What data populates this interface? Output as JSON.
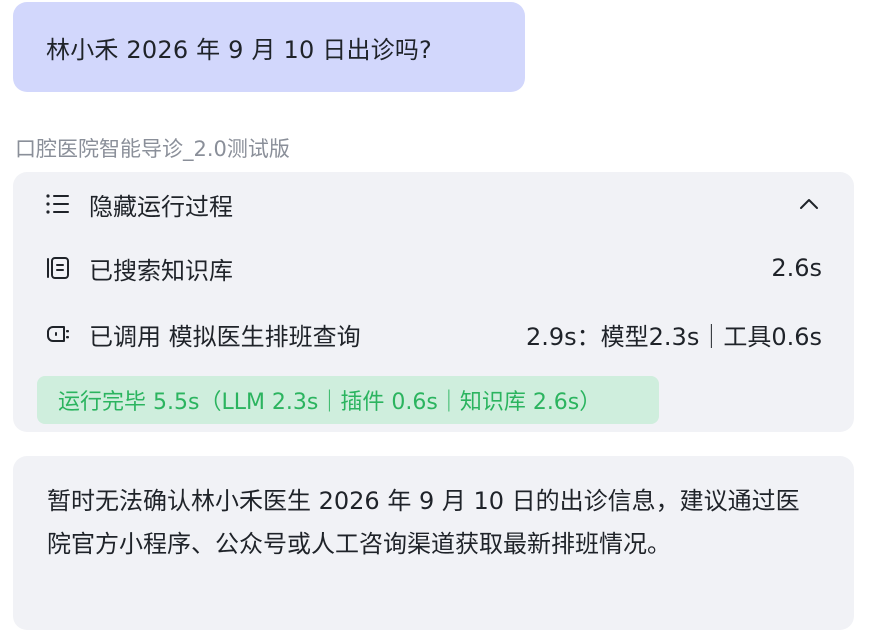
{
  "user_message": {
    "text": "林小禾 2026 年 9 月 10 日出诊吗?"
  },
  "bot": {
    "name": "口腔医院智能导诊_2.0测试版"
  },
  "process": {
    "toggle_label": "隐藏运行过程",
    "toggle_icon": "list-icon",
    "collapse_icon": "chevron-up-icon",
    "steps": [
      {
        "icon": "document-icon",
        "label": "已搜索知识库",
        "duration": "2.6s"
      },
      {
        "icon": "plugin-icon",
        "label": "已调用 模拟医生排班查询",
        "duration": "2.9s：模型2.3s｜工具0.6s"
      }
    ],
    "status": "运行完毕 5.5s（LLM 2.3s｜插件 0.6s｜知识库 2.6s）"
  },
  "answer": {
    "text": "暂时无法确认林小禾医生 2026 年 9 月 10 日的出诊信息，建议通过医院官方小程序、公众号或人工咨询渠道获取最新排班情况。"
  },
  "colors": {
    "user_bubble": "#d2d7fc",
    "card_bg": "#f1f2f6",
    "status_bg": "#cfeedd",
    "status_text": "#2bb45f",
    "muted_text": "#8a8f99"
  }
}
